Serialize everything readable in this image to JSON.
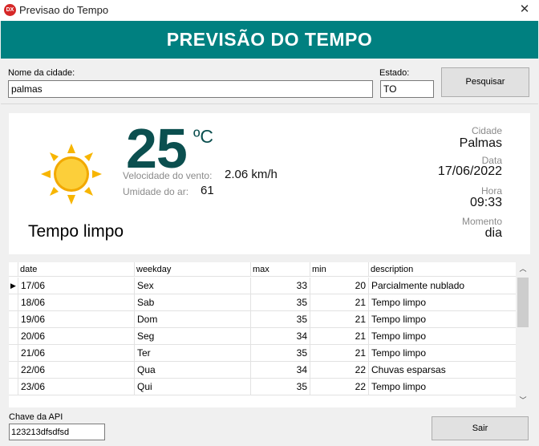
{
  "window": {
    "icon_text": "DX",
    "title": "Previsao do Tempo",
    "close_glyph": "✕"
  },
  "banner": {
    "title": "PREVISÃO DO TEMPO"
  },
  "search": {
    "city_label": "Nome da cidade:",
    "city_value": "palmas",
    "state_label": "Estado:",
    "state_value": "TO",
    "search_button": "Pesquisar"
  },
  "current": {
    "temperature": "25",
    "unit": "ºC",
    "wind_label": "Velocidade do vento:",
    "wind_value": "2.06 km/h",
    "humidity_label": "Umidade do ar:",
    "humidity_value": "61",
    "description": "Tempo limpo",
    "icon": "sun-icon",
    "city_label": "Cidade",
    "city_value": "Palmas",
    "date_label": "Data",
    "date_value": "17/06/2022",
    "time_label": "Hora",
    "time_value": "09:33",
    "moment_label": "Momento",
    "moment_value": "dia"
  },
  "forecast": {
    "columns": [
      "date",
      "weekday",
      "max",
      "min",
      "description"
    ],
    "rows": [
      {
        "date": "17/06",
        "weekday": "Sex",
        "max": "33",
        "min": "20",
        "description": "Parcialmente nublado"
      },
      {
        "date": "18/06",
        "weekday": "Sab",
        "max": "35",
        "min": "21",
        "description": "Tempo limpo"
      },
      {
        "date": "19/06",
        "weekday": "Dom",
        "max": "35",
        "min": "21",
        "description": "Tempo limpo"
      },
      {
        "date": "20/06",
        "weekday": "Seg",
        "max": "34",
        "min": "21",
        "description": "Tempo limpo"
      },
      {
        "date": "21/06",
        "weekday": "Ter",
        "max": "35",
        "min": "21",
        "description": "Tempo limpo"
      },
      {
        "date": "22/06",
        "weekday": "Qua",
        "max": "34",
        "min": "22",
        "description": "Chuvas esparsas"
      },
      {
        "date": "23/06",
        "weekday": "Qui",
        "max": "35",
        "min": "22",
        "description": "Tempo limpo"
      }
    ],
    "selected_row_marker": "▶",
    "scroll_up": "︿",
    "scroll_down": "﹀"
  },
  "footer": {
    "api_label": "Chave da API",
    "api_value": "123213dfsdfsd",
    "exit_button": "Sair"
  },
  "colors": {
    "banner": "#008080",
    "temperature": "#0b4f4f",
    "sun": "#f7b500"
  }
}
